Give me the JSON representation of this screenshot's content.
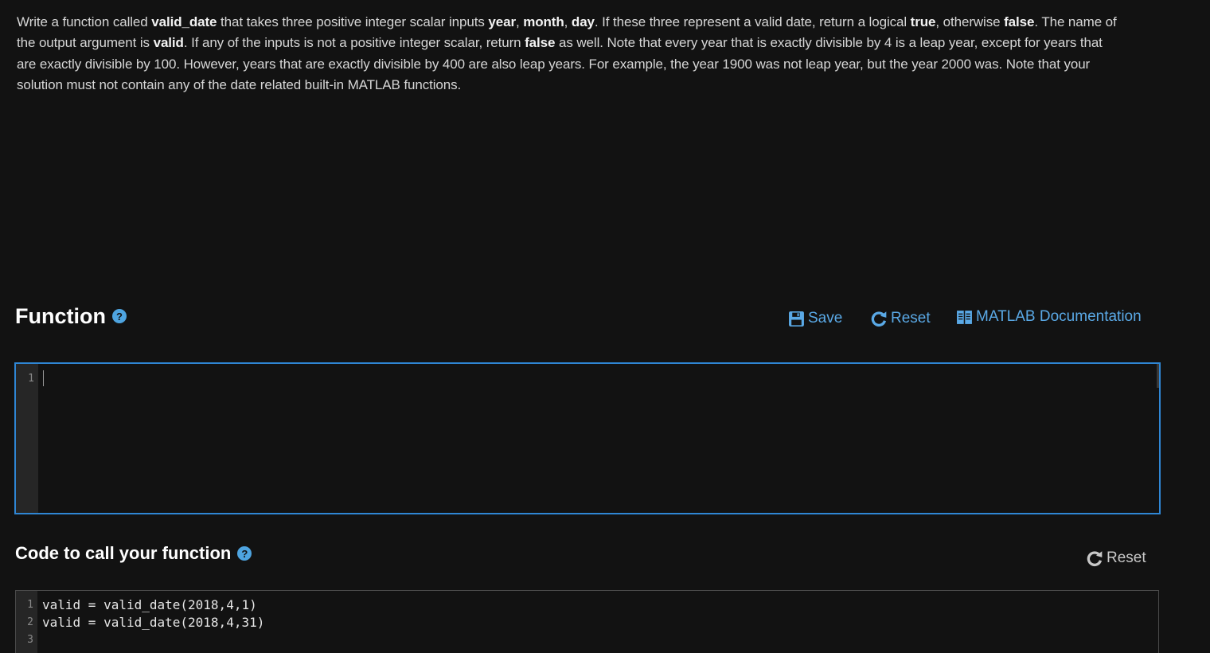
{
  "description": {
    "p1": "Write a function called ",
    "b1": "valid_date",
    "p2": " that takes three positive integer scalar inputs ",
    "b2": "year",
    "p3": ", ",
    "b3": "month",
    "p4": ", ",
    "b4": "day",
    "p5": ". If these three represent a valid date, return a logical ",
    "b5": "true",
    "p6": ", otherwise ",
    "b6": "false",
    "p7": ". The name of the output argument is ",
    "b7": "valid",
    "p8": ". If any of the inputs is not a positive integer scalar, return ",
    "b8": "false",
    "p9": " as well. Note that every year that is exactly divisible by 4 is a leap year, except for years that are exactly divisible by 100. However, years that are exactly divisible by 400 are also leap years. For example, the year 1900 was not leap year, but the year 2000 was. Note that your solution must not contain any of the date related built-in MATLAB functions."
  },
  "function_section": {
    "title": "Function",
    "help_icon": "question-circle",
    "save_label": "Save",
    "reset_label": "Reset",
    "docs_label": "MATLAB Documentation",
    "line_numbers": [
      "1"
    ]
  },
  "call_section": {
    "title": "Code to call your function",
    "help_icon": "question-circle",
    "reset_label": "Reset",
    "line_numbers": [
      "1",
      "2",
      "3"
    ],
    "code_lines": [
      "valid = valid_date(2018,4,1)",
      "valid = valid_date(2018,4,31)",
      ""
    ]
  },
  "colors": {
    "background": "#121212",
    "accent": "#5aa9e6",
    "editor_border_active": "#2f86d4"
  }
}
